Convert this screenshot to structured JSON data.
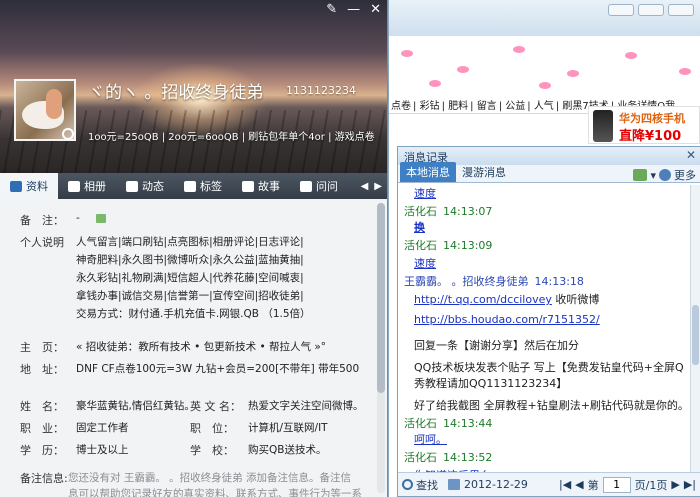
{
  "chat_window": {
    "ticker": [
      "点卷",
      "彩钻",
      "肥料",
      "留言",
      "公益",
      "人气",
      "刷黑7技术",
      "业务详情Q我"
    ],
    "ad": {
      "line1": "华为四核手机",
      "line2_prefix": "直降",
      "line2_price": "¥100"
    },
    "panel_title": "消息记录",
    "tabs": [
      "本地消息",
      "漫游消息"
    ],
    "more_label": "更多",
    "messages": [
      {
        "type": "body",
        "text": "速度",
        "style": "lnk",
        "top": 0
      },
      {
        "type": "head",
        "sender": "活化石",
        "time": "14:13:07",
        "me": false
      },
      {
        "type": "body",
        "text": "换",
        "style": "sq"
      },
      {
        "type": "head",
        "sender": "活化石",
        "time": "14:13:09",
        "me": false
      },
      {
        "type": "body",
        "text": "速度",
        "style": "lnk"
      },
      {
        "type": "head",
        "sender": "王霸霸。 。招收终身徒弟",
        "time": "14:13:18",
        "me": true
      },
      {
        "type": "body_link",
        "link": "http://t.qq.com/dccilovey",
        "suffix": "  收听微博"
      },
      {
        "type": "body_link",
        "link": "http://bbs.houdao.com/r7151352/",
        "suffix": ""
      },
      {
        "type": "body",
        "text": "回复一条【谢谢分享】然后在加分"
      },
      {
        "type": "body",
        "text": "QQ技术板块发表个贴子 写上【免费发钻皇代码+全屏Q"
      },
      {
        "type": "body",
        "text": "秀教程请加QQ1131123234】"
      },
      {
        "type": "body",
        "text": "好了给我截图 全屏教程+钻皇刷法+刷钻代码就是你的。"
      },
      {
        "type": "head",
        "sender": "活化石",
        "time": "14:13:44",
        "me": false
      },
      {
        "type": "body",
        "text": "呵呵。",
        "style": "lnk"
      },
      {
        "type": "head",
        "sender": "活化石",
        "time": "14:13:52",
        "me": false
      },
      {
        "type": "body",
        "text": "你知道这后果么",
        "style": "lnk"
      }
    ],
    "footer": {
      "search_label": "查找",
      "date": "2012-12-29",
      "page_prefix": "第",
      "page_value": "1",
      "page_suffix": "页/1页"
    }
  },
  "profile": {
    "nickname": "ヾ的ヽ 。招收终身徒弟",
    "qq_number": "1131123234",
    "signature": "1oo元=25oQB | 2oo元=6ooQB | 刷钻包年单个4or | 游戏点卷",
    "titlebar_icons": [
      "edit-icon",
      "minimize-icon",
      "close-icon"
    ],
    "tabs": [
      {
        "label": "资料",
        "active": true
      },
      {
        "label": "相册",
        "active": false
      },
      {
        "label": "动态",
        "active": false
      },
      {
        "label": "标签",
        "active": false
      },
      {
        "label": "故事",
        "active": false
      },
      {
        "label": "问问",
        "active": false
      }
    ],
    "fields": {
      "remark_label": "备　注：",
      "remark_value": "-",
      "personal_label": "个人说明",
      "personal_lines": [
        "人气留言|端口刷钻|点亮图标|相册评论|日志评论|",
        "神奇肥料|永久图书|微博听众|永久公益|蓝抽黄抽|",
        "永久彩钻|礼物刷满|短信超人|代养花藤|空间喊衷|",
        "拿钱办事|诚信交易|信誉第一|宣传空间|招收徒弟|",
        "交易方式：财付通.手机充值卡.网银.QB  （1.5倍）"
      ],
      "homepage_label": "主　页：",
      "homepage_value": "« 招收徒弟：教所有技术 • 包更新技术 • 帮拉人气 »°",
      "address_label": "地　址：",
      "address_value": "DNF CF点卷100元=3W 九钻+会员=200[不带年] 带年500",
      "name_label": "姓　名：",
      "name_value": "豪华蓝黄钻,情侣红黄钻。",
      "english_label": "英 文 名：",
      "english_value": "热爱文字关注空间微博。",
      "job_label": "职　业：",
      "job_value": "固定工作者",
      "position_label": "职　位：",
      "position_value": "计算机/互联网/IT",
      "edu_label": "学　历：",
      "edu_value": "博士及以上",
      "school_label": "学　校：",
      "school_value": "购买QB送技术。",
      "notes_label": "备注信息:",
      "notes_line1": "您还没有对 王霸霸。 。招收终身徒弟 添加备注信息。备注信",
      "notes_line2": "息可以帮助您记录好友的真实资料、联系方式、事件行为等一系"
    }
  }
}
